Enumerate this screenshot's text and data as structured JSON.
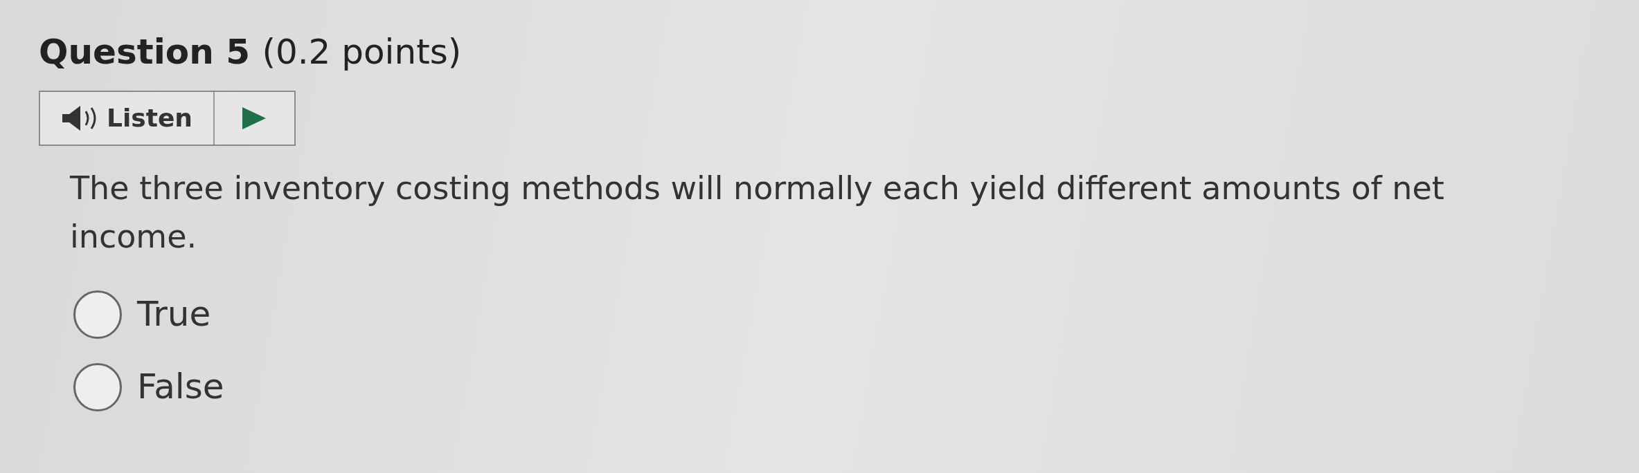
{
  "question": {
    "title": "Question 5",
    "points": "(0.2 points)"
  },
  "listen": {
    "label": "Listen"
  },
  "prompt": "The three inventory costing methods will normally each yield different amounts of net income.",
  "options": [
    {
      "label": "True",
      "selected": false
    },
    {
      "label": "False",
      "selected": false
    }
  ]
}
